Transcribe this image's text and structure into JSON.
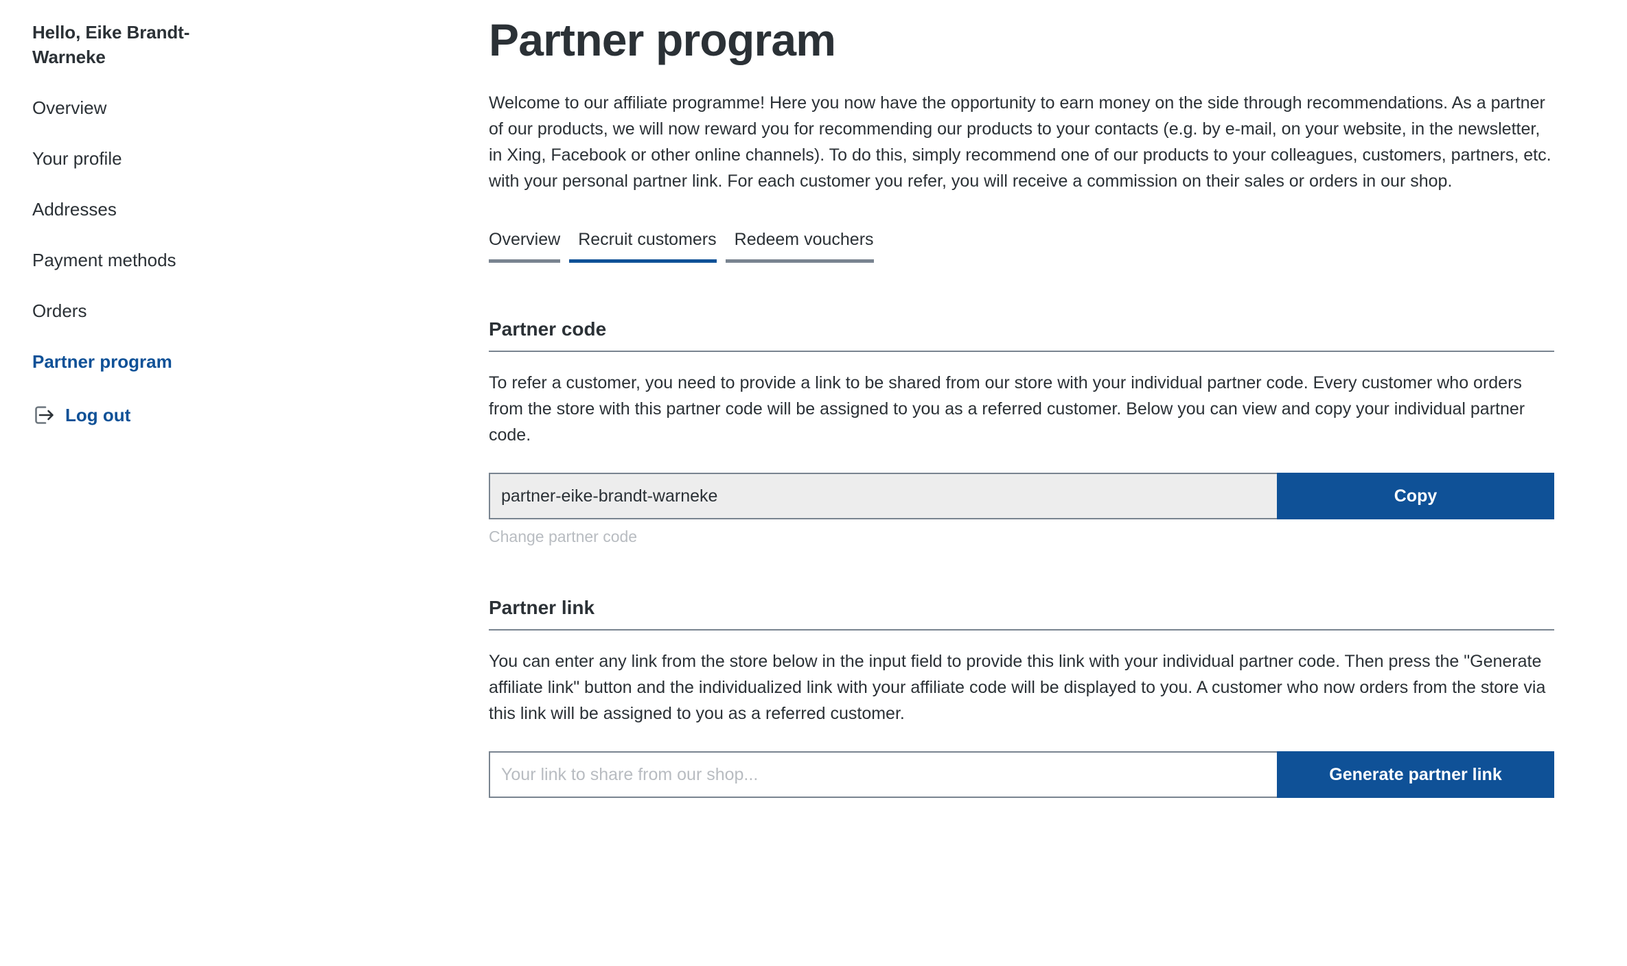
{
  "sidebar": {
    "greeting": "Hello, Eike Brandt-Warneke",
    "items": [
      {
        "label": "Overview",
        "active": false
      },
      {
        "label": "Your profile",
        "active": false
      },
      {
        "label": "Addresses",
        "active": false
      },
      {
        "label": "Payment methods",
        "active": false
      },
      {
        "label": "Orders",
        "active": false
      },
      {
        "label": "Partner program",
        "active": true
      }
    ],
    "logout": {
      "label": "Log out",
      "icon": "logout-icon"
    }
  },
  "main": {
    "title": "Partner program",
    "intro": "Welcome to our affiliate programme! Here you now have the opportunity to earn money on the side through recommendations. As a partner of our products, we will now reward you for recommending our products to your contacts (e.g. by e-mail, on your website, in the newsletter, in Xing, Facebook or other online channels). To do this, simply recommend one of our products to your colleagues, customers, partners, etc. with your personal partner link. For each customer you refer, you will receive a commission on their sales or orders in our shop.",
    "tabs": [
      {
        "label": "Overview",
        "active": false
      },
      {
        "label": "Recruit customers",
        "active": true
      },
      {
        "label": "Redeem vouchers",
        "active": false
      }
    ],
    "partner_code_section": {
      "title": "Partner code",
      "text": "To refer a customer, you need to provide a link to be shared from our store with your individual partner code. Every customer who orders from the store with this partner code will be assigned to you as a referred customer. Below you can view and copy your individual partner code.",
      "input_value": "partner-eike-brandt-warneke",
      "copy_button": "Copy",
      "change_link": "Change partner code"
    },
    "partner_link_section": {
      "title": "Partner link",
      "text": "You can enter any link from the store below in the input field to provide this link with your individual partner code. Then press the \"Generate affiliate link\" button and the individualized link with your affiliate code will be displayed to you. A customer who now orders from the store via this link will be assigned to you as a referred customer.",
      "input_placeholder": "Your link to share from our shop...",
      "generate_button": "Generate partner link"
    }
  },
  "colors": {
    "accent_blue": "#0f5197",
    "text_dark": "#2b3136",
    "rule_gray": "#798490",
    "input_gray_bg": "#ededed",
    "muted_link": "#b8bcc1"
  }
}
